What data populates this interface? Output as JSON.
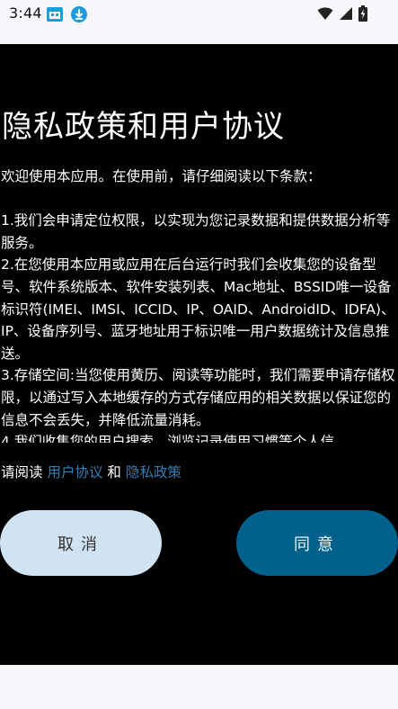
{
  "status_bar": {
    "time": "3:44",
    "icons": [
      "app-notification-icon",
      "download-icon",
      "wifi-icon",
      "signal-icon",
      "battery-charging-icon"
    ]
  },
  "dialog": {
    "title": "隐私政策和用户协议",
    "intro": "欢迎使用本应用。在使用前，请仔细阅读以下条款：",
    "clauses": [
      "1.我们会申请定位权限，以实现为您记录数据和提供数据分析等服务。",
      "2.在您使用本应用或应用在后台运行时我们会收集您的设备型号、软件系统版本、软件安装列表、Mac地址、BSSID唯一设备标识符(IMEI、IMSI、ICCID、IP、OAID、AndroidID、IDFA)、IP、设备序列号、蓝牙地址用于标识唯一用户数据统计及信息推送。",
      "3.存储空间:当您使用黄历、阅读等功能时，我们需要申请存储权限，以通过写入本地缓存的方式存储应用的相关数据以保证您的信息不会丢失，并降低流量消耗。",
      "4.我们收集您的用户搜索、浏览记录使用习惯等个人信"
    ],
    "consent": {
      "prefix": "请阅读 ",
      "user_agreement_link": "用户协议",
      "conjunction": " 和 ",
      "privacy_policy_link": "隐私政策"
    },
    "cancel_label": "取消",
    "agree_label": "同意"
  },
  "colors": {
    "dialog_bg": "#000000",
    "link": "#2f7fb8",
    "cancel_bg": "#cfe3f3",
    "agree_bg": "#00628c"
  }
}
